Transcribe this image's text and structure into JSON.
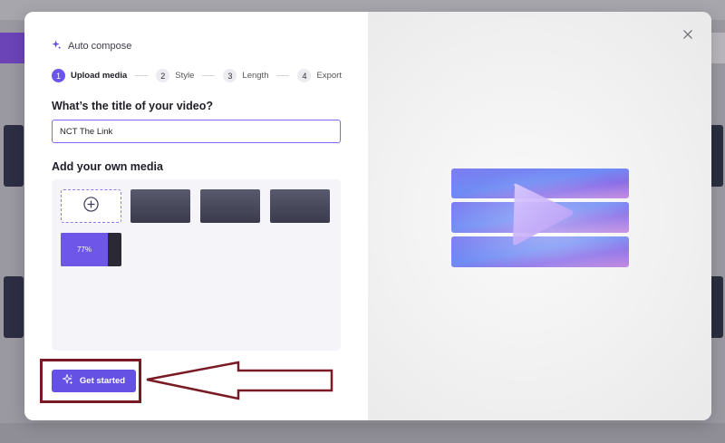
{
  "modal": {
    "header_title": "Auto compose",
    "steps": [
      {
        "num": "1",
        "label": "Upload media",
        "active": true
      },
      {
        "num": "2",
        "label": "Style",
        "active": false
      },
      {
        "num": "3",
        "label": "Length",
        "active": false
      },
      {
        "num": "4",
        "label": "Export",
        "active": false
      }
    ],
    "title_question": "What’s the title of your video?",
    "title_value": "NCT The Link",
    "media_label": "Add your own media",
    "media_items": [
      {
        "type": "add",
        "icon": "plus-circle-icon"
      },
      {
        "type": "video-thumb"
      },
      {
        "type": "video-thumb"
      },
      {
        "type": "video-thumb"
      },
      {
        "type": "uploading",
        "progress_percent": 77,
        "progress_label": "77%"
      }
    ],
    "get_started_label": "Get started",
    "get_started_icon": "sparkle-icon",
    "close_icon": "close-icon",
    "hero_icon": "video-play-icon"
  },
  "colors": {
    "accent": "#6551e3",
    "annotation": "#7a1a24"
  }
}
